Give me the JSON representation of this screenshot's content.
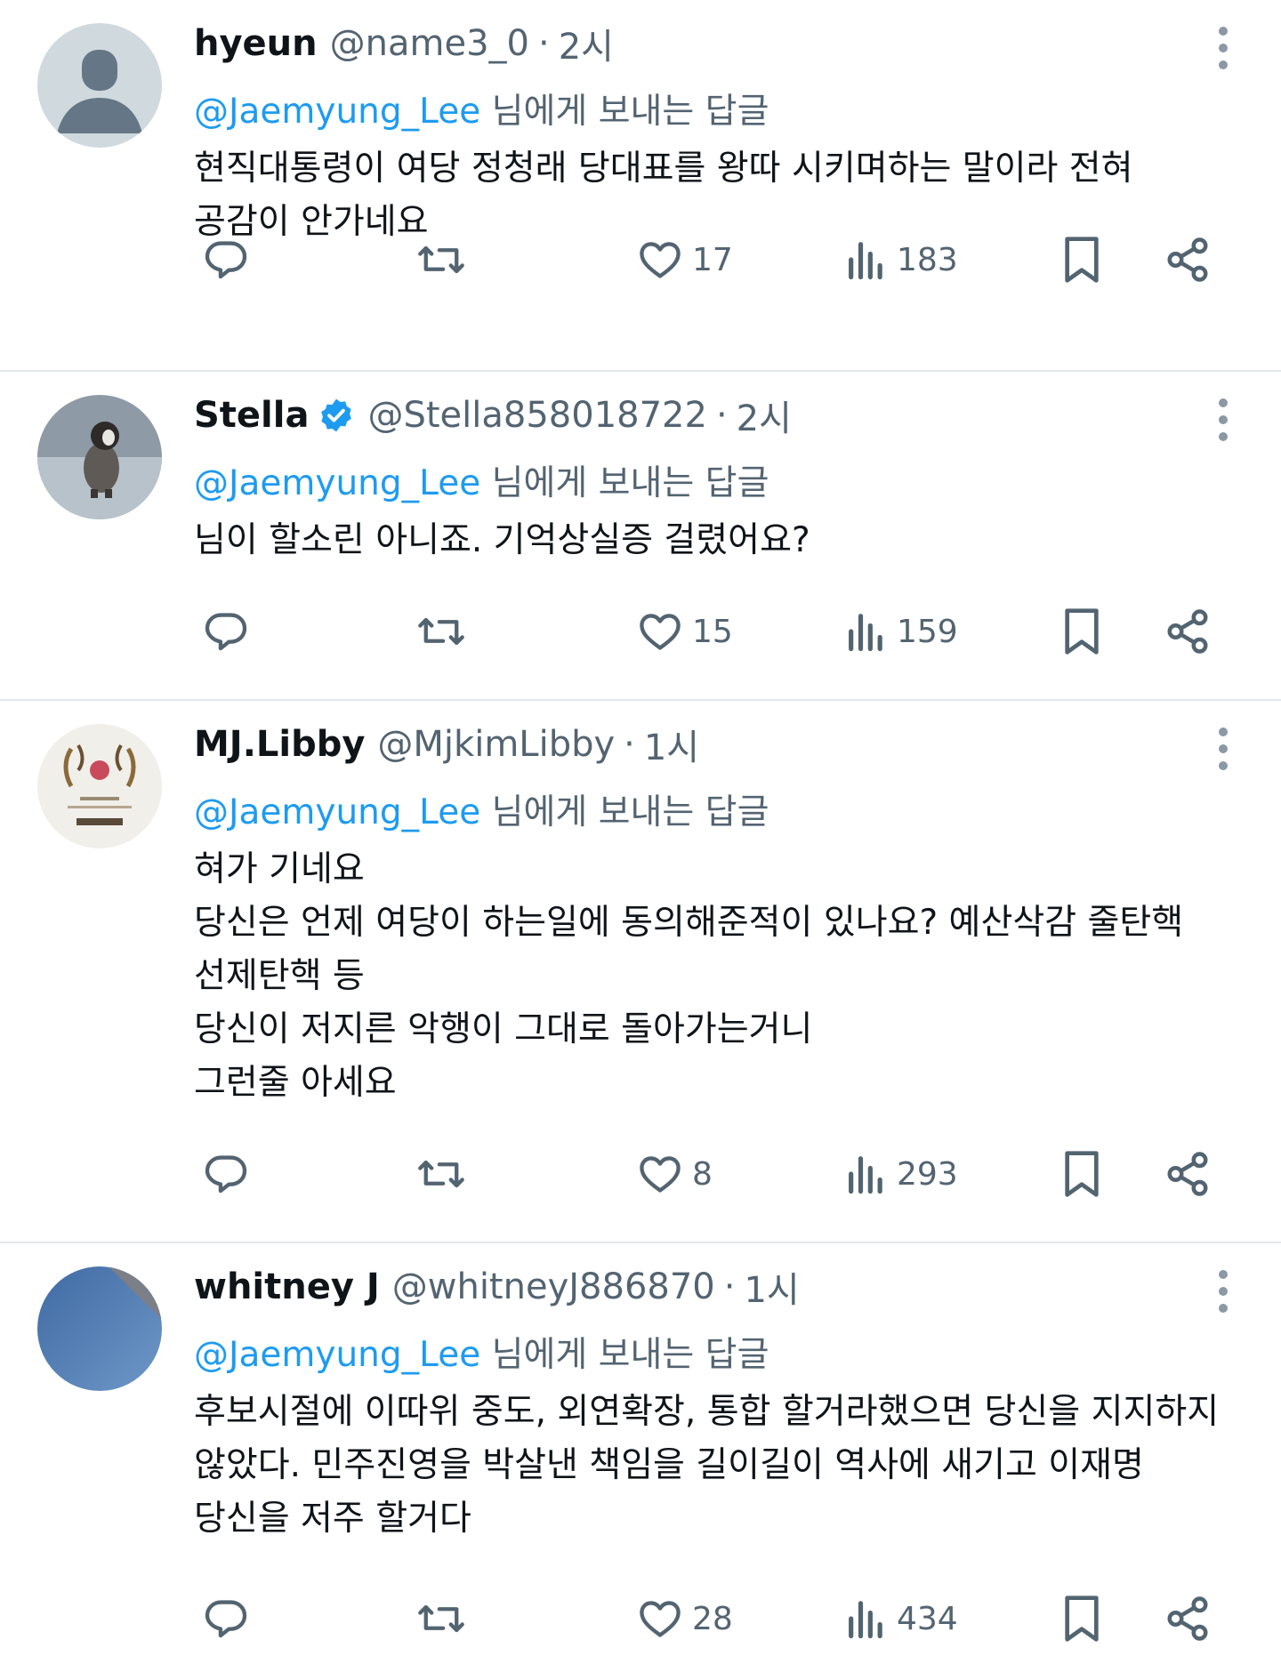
{
  "reply_label": "님에게 보내는 답글",
  "tweets": [
    {
      "name": "hyeun",
      "handle": "@name3_0",
      "time": "2시",
      "verified": false,
      "avatar": "default-avatar",
      "mention": "@Jaemyung_Lee",
      "lines": [
        "현직대통령이 여당 정청래 당대표를 왕따 시키며하는 말이라 전혀",
        "공감이 안가네요"
      ],
      "likes": "17",
      "views": "183"
    },
    {
      "name": "Stella",
      "handle": "@Stella858018722",
      "time": "2시",
      "verified": true,
      "avatar": "penguin-avatar",
      "mention": "@Jaemyung_Lee",
      "lines": [
        "님이 할소린 아니죠. 기억상실증 걸렸어요?"
      ],
      "likes": "15",
      "views": "159"
    },
    {
      "name": "MJ.Libby",
      "handle": "@MjkimLibby",
      "time": "1시",
      "verified": false,
      "avatar": "seal-avatar",
      "mention": "@Jaemyung_Lee",
      "lines": [
        "혀가 기네요",
        "당신은 언제 여당이 하는일에 동의해준적이 있나요? 예산삭감 줄탄핵",
        "선제탄핵 등",
        "당신이 저지른 악행이 그대로 돌아가는거니",
        "그런줄 아세요"
      ],
      "likes": "8",
      "views": "293"
    },
    {
      "name": "whitney J",
      "handle": "@whitneyJ886870",
      "time": "1시",
      "verified": false,
      "avatar": "blue-avatar",
      "mention": "@Jaemyung_Lee",
      "lines": [
        "후보시절에 이따위 중도, 외연확장, 통합 할거라했으면 당신을 지지하지",
        "않았다. 민주진영을 박살낸 책임을 길이길이 역사에 새기고 이재명",
        "당신을 저주 할거다"
      ],
      "likes": "28",
      "views": "434"
    }
  ],
  "colors": {
    "text": "#0f1419",
    "secondary": "#536471",
    "link": "#1d9bf0",
    "divider": "#e4e8eb"
  },
  "icons": [
    "reply-icon",
    "retweet-icon",
    "like-icon",
    "views-icon",
    "bookmark-icon",
    "share-icon",
    "more-icon",
    "verified-badge-icon"
  ]
}
